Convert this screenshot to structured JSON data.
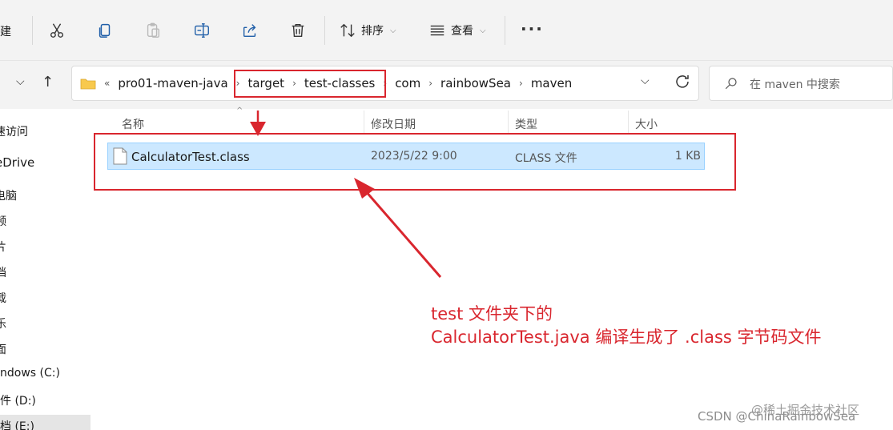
{
  "toolbar": {
    "left_clip": "建",
    "sort_label": "排序",
    "view_label": "查看",
    "more": "···",
    "icons": [
      "cut-icon",
      "copy-icon",
      "paste-icon",
      "rename-icon",
      "share-icon",
      "delete-icon"
    ]
  },
  "address": {
    "crumb_prefix": "«",
    "crumbs": [
      "pro01-maven-java",
      "target",
      "test-classes",
      "com",
      "rainbowSea",
      "maven"
    ],
    "search_placeholder": "在 maven 中搜索"
  },
  "sidebar": {
    "items": [
      {
        "label": "速访问"
      },
      {
        "label": "eDrive"
      },
      {
        "label": "电脑"
      },
      {
        "label": "频"
      },
      {
        "label": "片"
      },
      {
        "label": "档"
      },
      {
        "label": "载"
      },
      {
        "label": "乐"
      },
      {
        "label": "面"
      },
      {
        "label": "ndows (C:)"
      },
      {
        "label": "件 (D:)"
      },
      {
        "label": "档 (E:)"
      }
    ]
  },
  "columns": {
    "name": "名称",
    "modified": "修改日期",
    "type": "类型",
    "size": "大小"
  },
  "files": [
    {
      "name": "CalculatorTest.class",
      "modified": "2023/5/22 9:00",
      "type": "CLASS 文件",
      "size": "1 KB"
    }
  ],
  "annotation": {
    "line1": "test 文件夹下的",
    "line2": "CalculatorTest.java 编译生成了 .class 字节码文件",
    "color": "#d9262e"
  },
  "watermark": {
    "site": "@稀土掘金技术社区",
    "author": "CSDN @ChinaRainbowSea"
  }
}
